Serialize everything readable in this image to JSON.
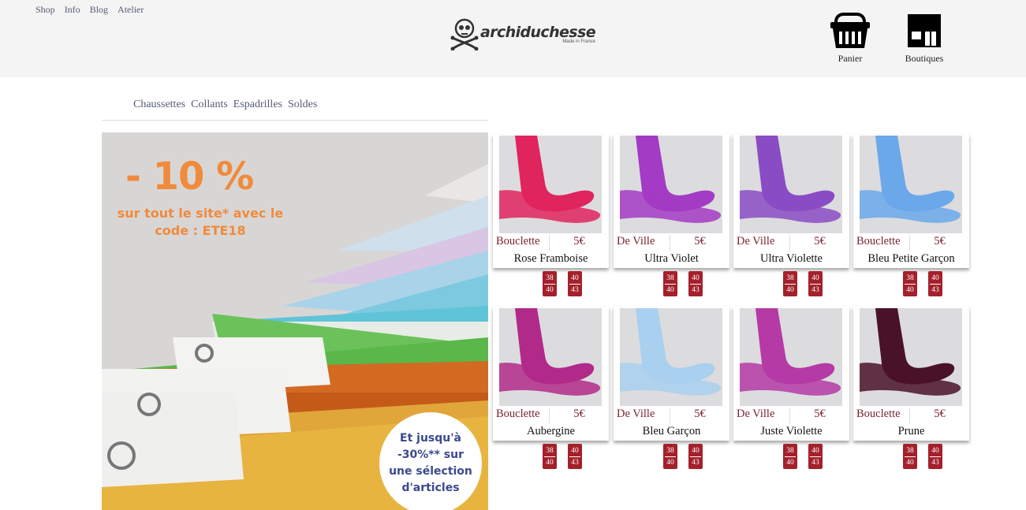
{
  "topnav": {
    "items": [
      "Shop",
      "Info",
      "Blog",
      "Atelier"
    ]
  },
  "logo": {
    "text": "archiduchesse",
    "sub": "Made in France"
  },
  "header": {
    "panier": "Panier",
    "boutiques": "Boutiques"
  },
  "categories": [
    "Chaussettes",
    "Collants",
    "Espadrilles",
    "Soldes"
  ],
  "banner": {
    "discount": "- 10 %",
    "line1": "sur tout le site*  avec le",
    "line2": "code : ETE18",
    "circle_line1": "Et jusqu'à",
    "circle_line2": "-30%** sur",
    "circle_line3": "une sélection",
    "circle_line4": "d'articles"
  },
  "products": [
    {
      "family": "Bouclette",
      "price": "5€",
      "name": "Rose Framboise",
      "color": "#e0245e",
      "sizes": [
        [
          "38",
          "40"
        ],
        [
          "40",
          "43"
        ]
      ]
    },
    {
      "family": "De Ville",
      "price": "5€",
      "name": "Ultra Violet",
      "color": "#a33bc4",
      "sizes": [
        [
          "38",
          "40"
        ],
        [
          "40",
          "43"
        ]
      ]
    },
    {
      "family": "De Ville",
      "price": "5€",
      "name": "Ultra Violette",
      "color": "#8a4cc4",
      "sizes": [
        [
          "38",
          "40"
        ],
        [
          "40",
          "43"
        ]
      ]
    },
    {
      "family": "Bouclette",
      "price": "5€",
      "name": "Bleu Petite Garçon",
      "color": "#6aa8ea",
      "sizes": [
        [
          "38",
          "40"
        ],
        [
          "40",
          "43"
        ]
      ]
    },
    {
      "family": "Bouclette",
      "price": "5€",
      "name": "Aubergine",
      "color": "#b12a8a",
      "sizes": [
        [
          "38",
          "40"
        ],
        [
          "40",
          "43"
        ]
      ]
    },
    {
      "family": "De Ville",
      "price": "5€",
      "name": "Bleu Garçon",
      "color": "#a9d0ee",
      "sizes": [
        [
          "38",
          "40"
        ],
        [
          "40",
          "43"
        ]
      ]
    },
    {
      "family": "De Ville",
      "price": "5€",
      "name": "Juste Violette",
      "color": "#b53aa6",
      "sizes": [
        [
          "38",
          "40"
        ],
        [
          "40",
          "43"
        ]
      ]
    },
    {
      "family": "Bouclette",
      "price": "5€",
      "name": "Prune",
      "color": "#4a1228",
      "sizes": [
        [
          "38",
          "40"
        ],
        [
          "40",
          "43"
        ]
      ]
    }
  ]
}
